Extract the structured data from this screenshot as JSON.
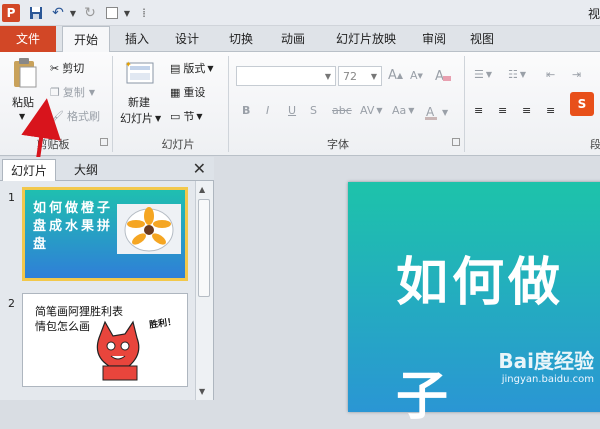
{
  "window": {
    "title_partial": "视"
  },
  "qat": {
    "app_letter": "P"
  },
  "tabs": [
    {
      "label": "文件"
    },
    {
      "label": "开始"
    },
    {
      "label": "插入"
    },
    {
      "label": "设计"
    },
    {
      "label": "切换"
    },
    {
      "label": "动画"
    },
    {
      "label": "幻灯片放映"
    },
    {
      "label": "审阅"
    },
    {
      "label": "视图"
    }
  ],
  "ribbon": {
    "clipboard": {
      "paste": "粘贴",
      "cut": "剪切",
      "copy": "复制",
      "format_painter": "格式刷",
      "group_label": "剪贴板"
    },
    "slides": {
      "new_slide_line1": "新建",
      "new_slide_line2": "幻灯片",
      "layout": "版式",
      "reset": "重设",
      "section": "节",
      "group_label": "幻灯片"
    },
    "font": {
      "size": "72",
      "group_label": "字体",
      "bold": "B",
      "italic": "I",
      "underline": "U",
      "shadow": "S",
      "strike": "abc",
      "spacing": "AV",
      "case": "Aa",
      "grow": "A",
      "shrink": "A"
    },
    "paragraph_label_partial": "段"
  },
  "panel": {
    "tab_slides": "幻灯片",
    "tab_outline": "大纲",
    "slides": [
      {
        "num": "1",
        "text": "如何做橙子盘成水果拼盘"
      },
      {
        "num": "2",
        "text": "简笔画阿狸胜利表情包怎么画",
        "bubble": "胜利！"
      }
    ]
  },
  "editor": {
    "title_line1": "如何做",
    "title_line2": "子"
  },
  "watermark": {
    "main": "Bai度经验",
    "sub": "jingyan.baidu.com"
  },
  "colors": {
    "accent": "#d24726",
    "slide_top": "#1dc3aa",
    "slide_bottom": "#2a96d4"
  }
}
